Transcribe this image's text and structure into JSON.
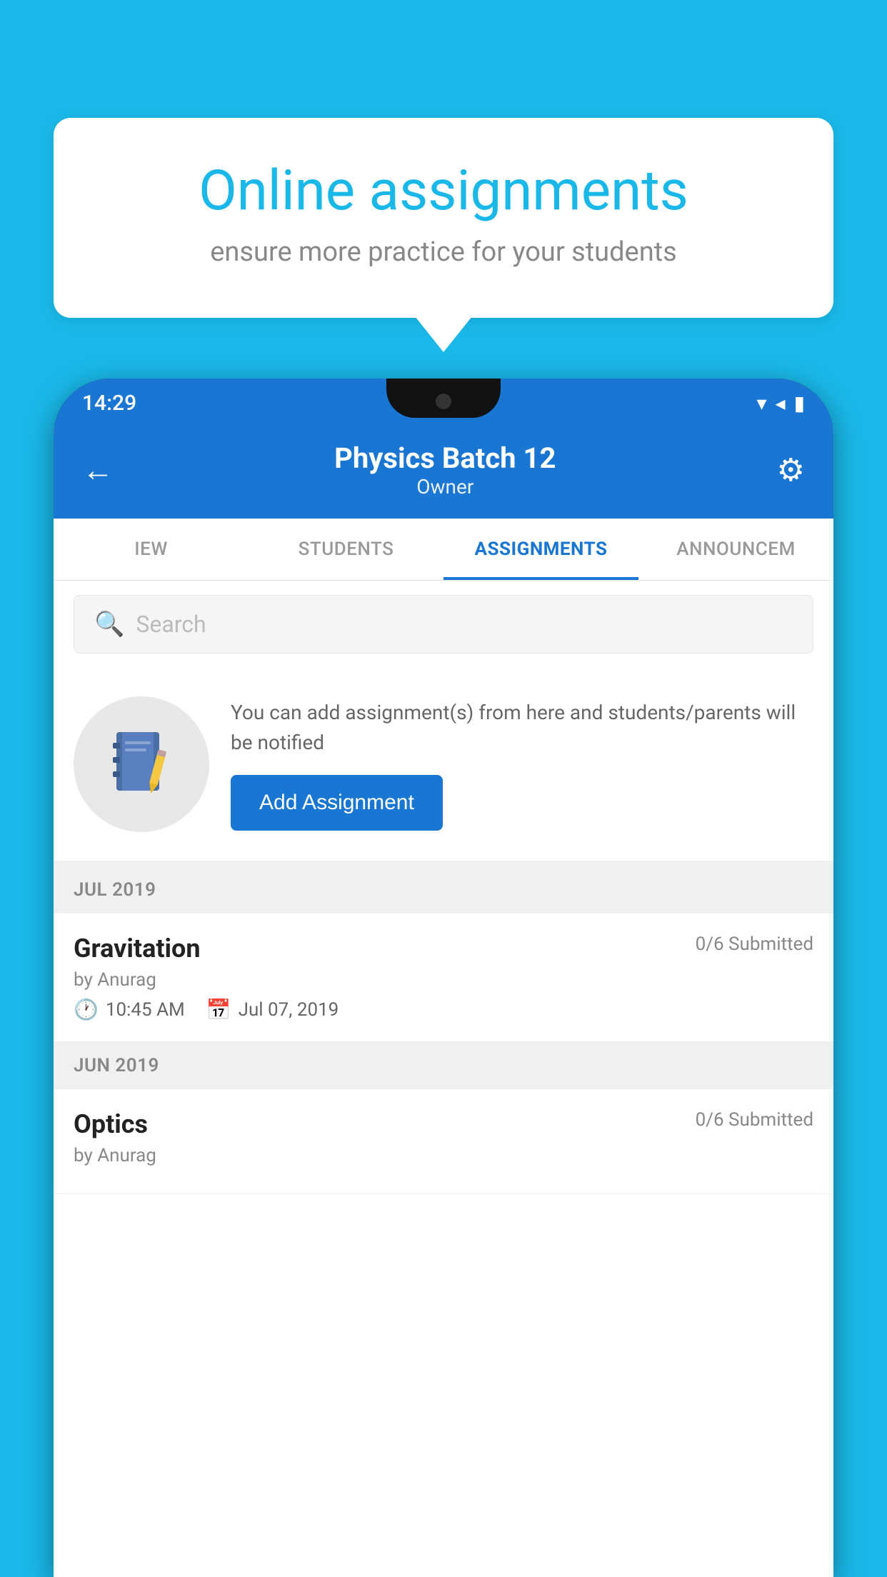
{
  "background": {
    "color": "#1ab8e8"
  },
  "speech_bubble": {
    "title": "Online assignments",
    "subtitle": "ensure more practice for your students"
  },
  "status_bar": {
    "time": "14:29",
    "wifi_icon": "▼",
    "signal_icon": "▲",
    "battery_icon": "▮"
  },
  "app_header": {
    "title": "Physics Batch 12",
    "subtitle": "Owner",
    "back_icon": "←",
    "settings_icon": "⚙"
  },
  "tabs": [
    {
      "label": "IEW",
      "active": false
    },
    {
      "label": "STUDENTS",
      "active": false
    },
    {
      "label": "ASSIGNMENTS",
      "active": true
    },
    {
      "label": "ANNOUNCEM",
      "active": false
    }
  ],
  "search": {
    "placeholder": "Search"
  },
  "promo": {
    "description": "You can add assignment(s) from here and students/parents will be notified",
    "add_button_label": "Add Assignment"
  },
  "sections": [
    {
      "month": "JUL 2019",
      "assignments": [
        {
          "name": "Gravitation",
          "submitted": "0/6 Submitted",
          "by": "by Anurag",
          "time": "10:45 AM",
          "date": "Jul 07, 2019"
        }
      ]
    },
    {
      "month": "JUN 2019",
      "assignments": [
        {
          "name": "Optics",
          "submitted": "0/6 Submitted",
          "by": "by Anurag",
          "time": "",
          "date": ""
        }
      ]
    }
  ]
}
